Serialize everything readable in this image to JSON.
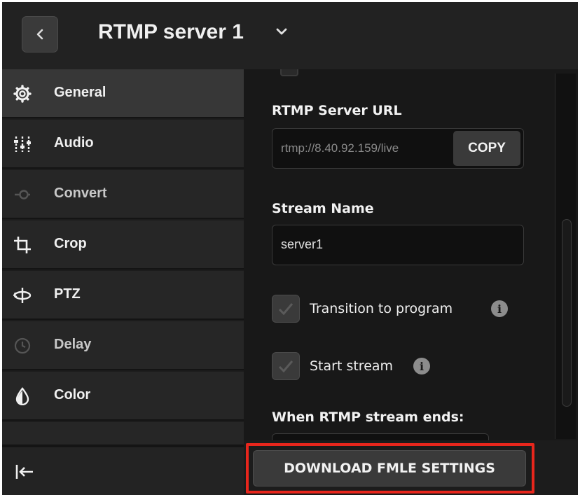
{
  "header": {
    "back_icon": "chevron-left-icon",
    "title": "RTMP server 1",
    "title_menu_icon": "chevron-down-icon"
  },
  "sidebar": {
    "items": [
      {
        "label": "General",
        "icon": "gear-icon",
        "active": true
      },
      {
        "label": "Audio",
        "icon": "audio-mixer-icon",
        "active": false
      },
      {
        "label": "Convert",
        "icon": "convert-icon",
        "active": false,
        "disabled": true
      },
      {
        "label": "Crop",
        "icon": "crop-icon",
        "active": false
      },
      {
        "label": "PTZ",
        "icon": "ptz-icon",
        "active": false
      },
      {
        "label": "Delay",
        "icon": "clock-icon",
        "active": false,
        "disabled": true
      },
      {
        "label": "Color",
        "icon": "droplet-icon",
        "active": false
      }
    ],
    "collapse_icon": "collapse-left-icon"
  },
  "panel": {
    "rtmp_url_label": "RTMP Server URL",
    "rtmp_url_value": "rtmp://8.40.92.159/live",
    "copy_label": "COPY",
    "stream_name_label": "Stream Name",
    "stream_name_value": "server1",
    "transition_label": "Transition to program",
    "transition_checked": true,
    "start_stream_label": "Start stream",
    "start_stream_checked": true,
    "info_glyph": "i",
    "ends_label": "When RTMP stream ends:"
  },
  "footer": {
    "download_label": "DOWNLOAD FMLE SETTINGS"
  },
  "colors": {
    "highlight_border": "#e8261c",
    "background": "#1e1e1e",
    "button": "#3a3a3a"
  }
}
